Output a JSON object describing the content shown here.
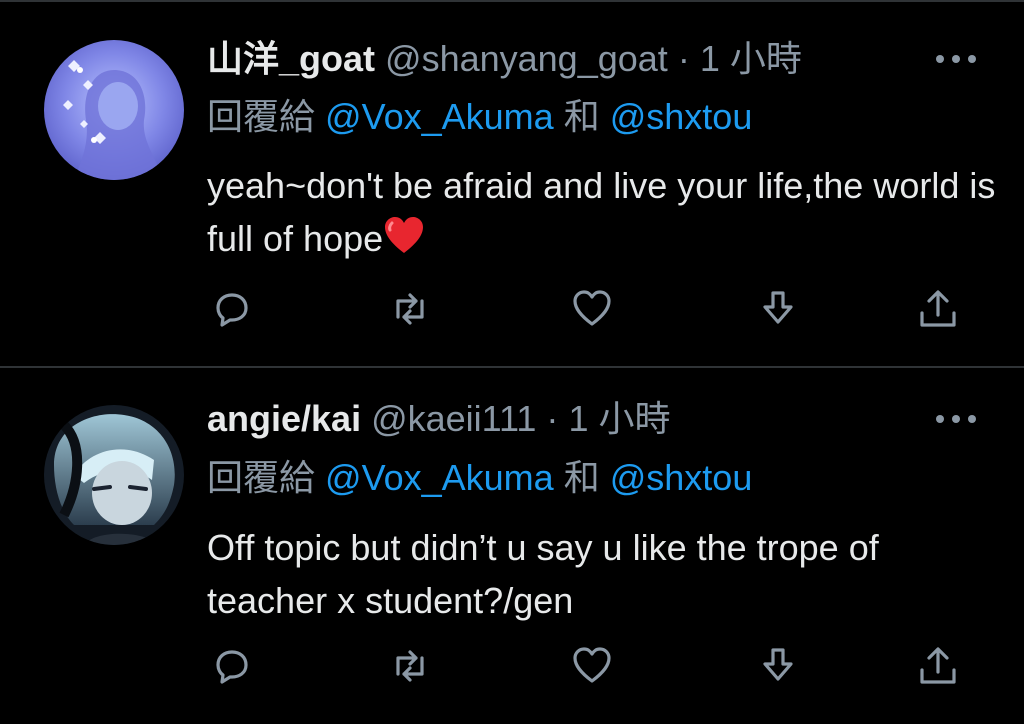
{
  "tweets": [
    {
      "display_name": "山洋_goat",
      "handle": "@shanyang_goat",
      "separator": "·",
      "time": "1 小時",
      "reply_prefix": "回覆給",
      "mention_1": "@Vox_Akuma",
      "conjunction": "和",
      "mention_2": "@shxtou",
      "text": "yeah~don't be afraid and live your life,the world is full of hope",
      "emoji": "red-heart-emoji"
    },
    {
      "display_name": "angie/kai",
      "handle": "@kaeii111",
      "separator": "·",
      "time": "1 小時",
      "reply_prefix": "回覆給",
      "mention_1": "@Vox_Akuma",
      "conjunction": "和",
      "mention_2": "@shxtou",
      "text": "Off topic but didn’t u say u like the trope of teacher x student?/gen"
    }
  ],
  "icons": {
    "reply": "reply-icon",
    "retweet": "retweet-icon",
    "like": "heart-icon",
    "download": "download-icon",
    "share": "share-icon",
    "more": "more-icon"
  },
  "colors": {
    "background": "#000000",
    "text": "#e7e9ea",
    "muted": "#8b98a5",
    "link": "#1d9bf0",
    "divider": "#2f3336"
  }
}
